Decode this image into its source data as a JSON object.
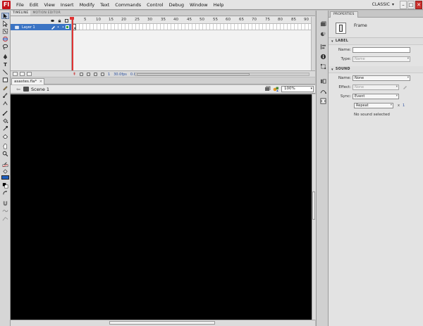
{
  "app": {
    "logo_letter": "Fl",
    "workspace": "CLASSIC",
    "colors": {
      "accent": "#3b74c4",
      "logo": "#c3131a",
      "stage": "#000000",
      "playhead": "#e03434",
      "keyframe_layer": "#2ea12e",
      "fill": "#1e5fbf"
    }
  },
  "menu": [
    "File",
    "Edit",
    "View",
    "Insert",
    "Modify",
    "Text",
    "Commands",
    "Control",
    "Debug",
    "Window",
    "Help"
  ],
  "window_controls": {
    "minimize": "–",
    "maximize": "□",
    "close": "✕"
  },
  "timeline": {
    "tabs": [
      "TIMELINE",
      "MOTION EDITOR"
    ],
    "layer_name": "Layer 1",
    "ruler": [
      "5",
      "10",
      "15",
      "20",
      "25",
      "30",
      "35",
      "40",
      "45",
      "50",
      "55",
      "60",
      "65",
      "70",
      "75",
      "80",
      "85",
      "90"
    ],
    "status": {
      "current_frame": "1",
      "fps": "30.0fps",
      "elapsed": "0.0s"
    }
  },
  "document": {
    "tab_name": "asastes.fla*",
    "close_glyph": "×",
    "scene": "Scene 1",
    "zoom": "100%"
  },
  "properties": {
    "tab": "PROPERTIES",
    "object_type": "Frame",
    "label_section": "LABEL",
    "label_name_label": "Name:",
    "label_name_value": "",
    "label_type_label": "Type:",
    "label_type_value": "Name",
    "sound_section": "SOUND",
    "sound_name_label": "Name:",
    "sound_name_value": "None",
    "effect_label": "Effect:",
    "effect_value": "None",
    "sync_label": "Sync:",
    "sync_value": "Event",
    "repeat_value": "Repeat",
    "repeat_x": "x",
    "repeat_count": "1",
    "no_sound": "No sound selected"
  }
}
